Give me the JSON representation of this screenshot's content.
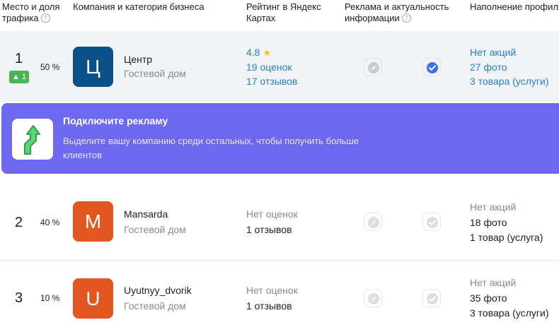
{
  "header": {
    "place_share": "Место и доля трафика",
    "company_category": "Компания и категория бизнеса",
    "rating": "Рейтинг в Яндекс Картах",
    "ads_actuality": "Реклама и актуальность информации",
    "profile_fill": "Наполнение профиля",
    "help_glyph": "?"
  },
  "rows": [
    {
      "place": "1",
      "delta": "▲ 1",
      "share": "50 %",
      "logo_letter": "Ц",
      "name": "Центр",
      "category": "Гостевой дом",
      "rating_value": "4.8",
      "ratings_count": "19 оценок",
      "reviews_count": "17 отзывов",
      "ads_active": false,
      "info_verified": true,
      "promos": "Нет акций",
      "photos": "27 фото",
      "goods": "3 товара (услуги)"
    },
    {
      "place": "2",
      "share": "40 %",
      "logo_letter": "M",
      "name": "Mansarda",
      "category": "Гостевой дом",
      "rating_value": "Нет оценок",
      "reviews_count": "1 отзывов",
      "ads_active": false,
      "info_verified": false,
      "promos": "Нет акций",
      "photos": "18 фото",
      "goods": "1 товар (услуга)"
    },
    {
      "place": "3",
      "share": "10 %",
      "logo_letter": "U",
      "name": "Uyutnyy_dvorik",
      "category": "Гостевой дом",
      "rating_value": "Нет оценок",
      "reviews_count": "1 отзывов",
      "ads_active": false,
      "info_verified": false,
      "promos": "Нет акций",
      "photos": "35 фото",
      "goods": "3 товара (услуги)"
    }
  ],
  "promo": {
    "title": "Подключите рекламу",
    "text": "Выделите вашу компанию среди остальных, чтобы получить больше клиентов",
    "icon": "growth-arrow-icon"
  },
  "icons": {
    "star": "★",
    "ads": "compass-arrow-icon",
    "verified": "check-badge-icon"
  },
  "colors": {
    "link": "#2780c8",
    "promo_bg": "#6e68ee",
    "logo_1": "#0a5089",
    "logo_2": "#e25620",
    "logo_3": "#e25620",
    "delta_up": "#46b755",
    "verified": "#3d73e6"
  }
}
